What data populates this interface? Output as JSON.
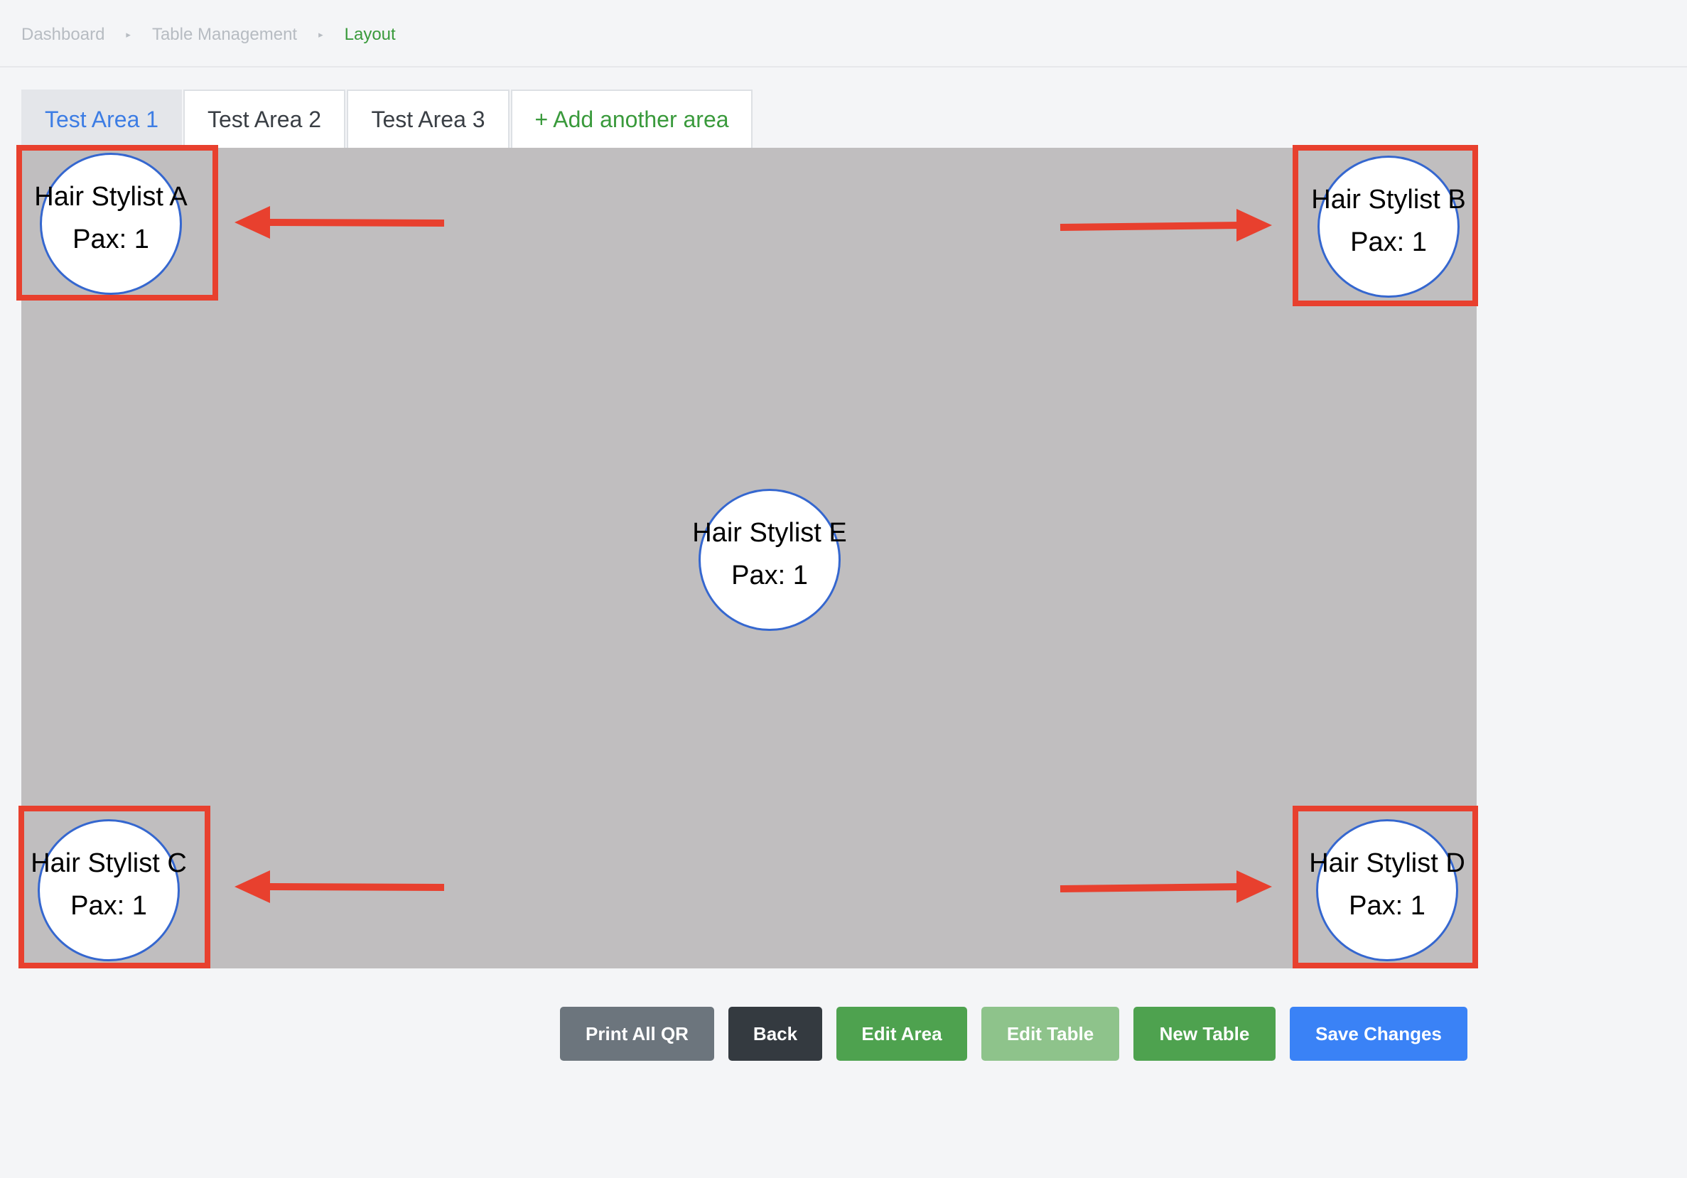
{
  "breadcrumb": {
    "items": [
      "Dashboard",
      "Table Management",
      "Layout"
    ],
    "separator": "▸"
  },
  "tabs": [
    {
      "label": "Test Area 1",
      "active": true
    },
    {
      "label": "Test Area 2",
      "active": false
    },
    {
      "label": "Test Area 3",
      "active": false
    },
    {
      "label": "+ Add another area",
      "active": false
    }
  ],
  "tables": [
    {
      "name": "Hair Stylist A",
      "pax": "Pax: 1"
    },
    {
      "name": "Hair Stylist B",
      "pax": "Pax: 1"
    },
    {
      "name": "Hair Stylist E",
      "pax": "Pax: 1"
    },
    {
      "name": "Hair Stylist C",
      "pax": "Pax: 1"
    },
    {
      "name": "Hair Stylist D",
      "pax": "Pax: 1"
    }
  ],
  "buttons": {
    "print_qr": "Print All QR",
    "back": "Back",
    "edit_area": "Edit Area",
    "edit_table": "Edit Table",
    "new_table": "New Table",
    "save": "Save Changes"
  },
  "colors": {
    "accent_blue": "#3d7de4",
    "accent_green": "#3a9a3c",
    "annotation_red": "#e8402e",
    "canvas_bg": "#c0bebf",
    "table_border": "#3567cf"
  }
}
